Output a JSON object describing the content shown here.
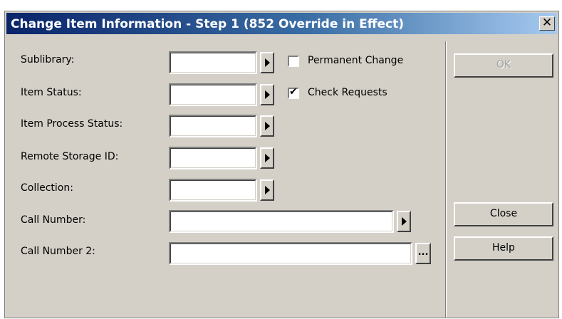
{
  "window": {
    "title": "Change Item Information - Step 1 (852 Override in Effect)",
    "close_glyph": "✕"
  },
  "form": {
    "fields": [
      {
        "label": "Sublibrary:",
        "value": ""
      },
      {
        "label": "Item Status:",
        "value": ""
      },
      {
        "label": "Item Process Status:",
        "value": ""
      },
      {
        "label": "Remote Storage ID:",
        "value": ""
      },
      {
        "label": "Collection:",
        "value": ""
      },
      {
        "label": "Call Number:",
        "value": ""
      },
      {
        "label": "Call Number 2:",
        "value": ""
      }
    ],
    "ellipsis_glyph": "..."
  },
  "options": {
    "permanent_change": {
      "label": "Permanent Change",
      "checked": false
    },
    "check_requests": {
      "label": "Check Requests",
      "checked": true
    }
  },
  "buttons": {
    "ok": "OK",
    "close": "Close",
    "help": "Help"
  }
}
